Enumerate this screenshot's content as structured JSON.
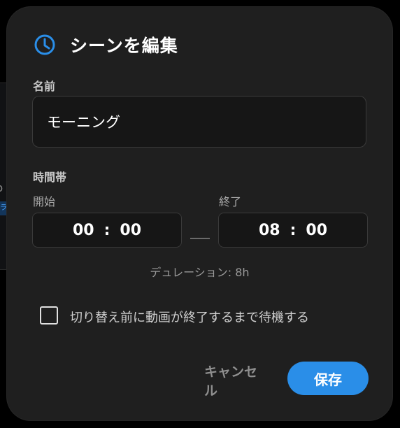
{
  "background": {
    "glyph_top": "(",
    "glyph_bottom": "p",
    "tag_text": "ラ"
  },
  "dialog": {
    "title": "シーンを編集",
    "title_icon": "clock-icon",
    "accent_color": "#2a8ee8"
  },
  "name_section": {
    "label": "名前",
    "value": "モーニング"
  },
  "time_section": {
    "label": "時間帯",
    "start_label": "開始",
    "end_label": "終了",
    "start_hour": "00",
    "start_minute": "00",
    "end_hour": "08",
    "end_minute": "00",
    "separator": ":",
    "duration": "デュレーション: 8h"
  },
  "option": {
    "label": "切り替え前に動画が終了するまで待機する",
    "checked": false
  },
  "actions": {
    "cancel_label": "キャンセル",
    "save_label": "保存"
  }
}
